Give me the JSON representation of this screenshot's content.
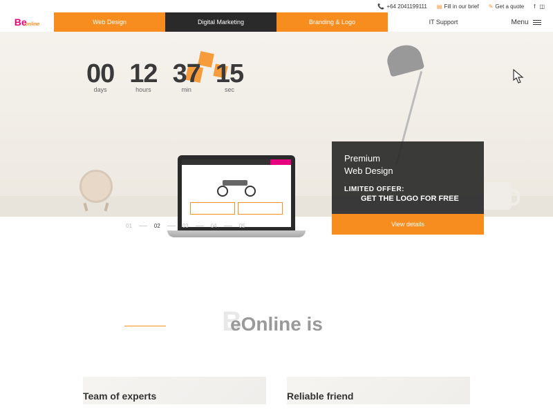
{
  "topbar": {
    "phone": "+64 2041199111",
    "brief": "Fill in our brief",
    "quote": "Get a quote"
  },
  "logo": {
    "be": "Be",
    "online": "online"
  },
  "nav": {
    "web": "Web Design",
    "marketing": "Digital Marketing",
    "branding": "Branding & Logo",
    "it": "IT Support"
  },
  "menu": "Menu",
  "countdown": {
    "days": {
      "num": "00",
      "lbl": "days"
    },
    "hours": {
      "num": "12",
      "lbl": "hours"
    },
    "min": {
      "num": "37",
      "lbl": "min"
    },
    "sec": {
      "num": "15",
      "lbl": "sec"
    }
  },
  "promo": {
    "title1": "Premium",
    "title2": "Web Design",
    "offer": "LIMITED OFFER:",
    "sub": "GET THE LOGO FOR FREE",
    "btn": "View details"
  },
  "pager": {
    "p1": "01",
    "p2": "02",
    "p3": "03",
    "p4": "04",
    "p5": "05"
  },
  "section": {
    "title": "eOnline is",
    "bigB": "B"
  },
  "cards": {
    "c1": "Team of experts",
    "c2": "Reliable friend"
  }
}
